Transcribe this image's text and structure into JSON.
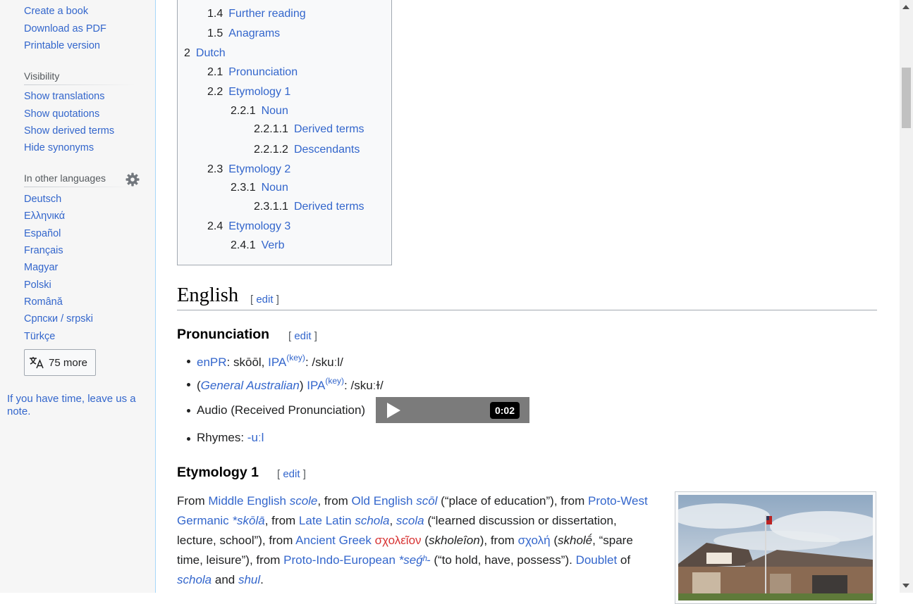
{
  "sidebar": {
    "tools": [
      "Create a book",
      "Download as PDF",
      "Printable version"
    ],
    "visibility_heading": "Visibility",
    "visibility": [
      "Show translations",
      "Show quotations",
      "Show derived terms",
      "Hide synonyms"
    ],
    "languages_heading": "In other languages",
    "languages": [
      "Deutsch",
      "Ελληνικά",
      "Español",
      "Français",
      "Magyar",
      "Polski",
      "Română",
      "Српски / srpski",
      "Türkçe"
    ],
    "more_label": "75 more",
    "note_prefix": "If you have time, leave us a ",
    "note_link": "note",
    "note_suffix": "."
  },
  "toc": [
    {
      "num": "1.4",
      "text": "Further reading"
    },
    {
      "num": "1.5",
      "text": "Anagrams"
    },
    {
      "num": "2",
      "text": "Dutch"
    },
    {
      "num": "2.1",
      "text": "Pronunciation"
    },
    {
      "num": "2.2",
      "text": "Etymology 1"
    },
    {
      "num": "2.2.1",
      "text": "Noun"
    },
    {
      "num": "2.2.1.1",
      "text": "Derived terms"
    },
    {
      "num": "2.2.1.2",
      "text": "Descendants"
    },
    {
      "num": "2.3",
      "text": "Etymology 2"
    },
    {
      "num": "2.3.1",
      "text": "Noun"
    },
    {
      "num": "2.3.1.1",
      "text": "Derived terms"
    },
    {
      "num": "2.4",
      "text": "Etymology 3"
    },
    {
      "num": "2.4.1",
      "text": "Verb"
    }
  ],
  "content": {
    "english_heading": "English",
    "edit_label": "edit",
    "pronunciation_heading": "Pronunciation",
    "pron1": {
      "enpr": "enPR",
      "enpr_value": "skōōl",
      "ipa": "IPA",
      "key": "(key)",
      "ipa_value": "/skuːl/"
    },
    "pron2": {
      "accent": "General Australian",
      "ipa": "IPA",
      "key": "(key)",
      "ipa_value": "/skuːɫ/"
    },
    "audio_label": "Audio (Received Pronunciation)",
    "audio_time": "0:02",
    "rhymes_label": "Rhymes: ",
    "rhymes_value": "-uːl",
    "etymology_heading": "Etymology 1",
    "etym": {
      "t1": "From ",
      "l1": "Middle English",
      "w1": "scole",
      "t2": ", from ",
      "l2": "Old English",
      "w2": "scōl",
      "t3": " (“place of education”), from ",
      "l3": "Proto-West Germanic",
      "w3": "*skōlā",
      "t4": ", from ",
      "l4": "Late Latin",
      "w4": "schola",
      "t4b": ", ",
      "w4b": "scola",
      "t5": " (“learned discussion or dissertation, lecture, school”), from ",
      "l5": "Ancient Greek",
      "w5": "σχολεῖον",
      "t6": " (",
      "w6": "skholeîon",
      "t6b": "), from ",
      "w7": "σχολή",
      "t7": " (",
      "w8": "skholḗ",
      "t8": ", “spare time, leisure”), from ",
      "l8": "Proto-Indo-European",
      "w9": "*seǵʰ-",
      "t9": " (“to hold, have, possess”). ",
      "l9": "Doublet",
      "t10": " of ",
      "w10": "schola",
      "t11": " and ",
      "w11": "shul",
      "t12": "."
    }
  },
  "colors": {
    "link": "#3366cc",
    "redlink": "#d73333",
    "sidebar_bg": "#f6f6f6",
    "player_bg": "#7b7b7b"
  }
}
